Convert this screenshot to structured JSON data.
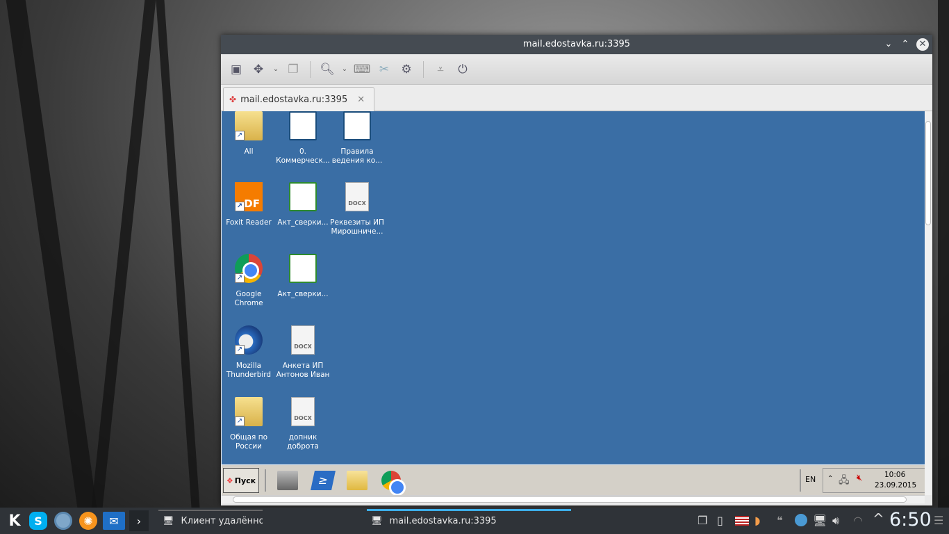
{
  "window": {
    "title": "mail.edostavka.ru:3395",
    "tab_label": "mail.edostavka.ru:3395"
  },
  "toolbar": {
    "icons": [
      "view-fullscreen-icon",
      "scale-icon",
      "dropdown",
      "multi-window-icon",
      "zoom-icon",
      "dropdown",
      "keyboard-icon",
      "tools-icon",
      "preferences-icon",
      "minimize-icon",
      "disconnect-icon"
    ]
  },
  "remote_desktop": {
    "background": "#3a6ea5",
    "icons": [
      {
        "label": "All",
        "type": "folder-shortcut"
      },
      {
        "label": "0. Коммерческ...",
        "type": "writer"
      },
      {
        "label": "Правила ведения ко...",
        "type": "writer"
      },
      {
        "label": "Foxit Reader",
        "type": "pdf-shortcut"
      },
      {
        "label": "Акт_сверки...",
        "type": "calc"
      },
      {
        "label": "Реквезиты ИП Мирошниче...",
        "type": "docx",
        "badge": "DOCX"
      },
      {
        "label": "Google Chrome",
        "type": "chrome-shortcut"
      },
      {
        "label": "Акт_сверки...",
        "type": "calc"
      },
      {
        "label": "Mozilla Thunderbird",
        "type": "thunderbird-shortcut"
      },
      {
        "label": "Анкета ИП Антонов Иван",
        "type": "docx",
        "badge": "DOCX"
      },
      {
        "label": "Общая по России",
        "type": "folder-shortcut"
      },
      {
        "label": "допник доброта",
        "type": "docx",
        "badge": "DOCX"
      }
    ],
    "taskbar": {
      "start_label": "Пуск",
      "language": "EN",
      "time": "10:06",
      "date": "23.09.2015"
    }
  },
  "panel": {
    "launchers": [
      "kde-menu",
      "skype",
      "chromium",
      "clementine",
      "mail"
    ],
    "tasks": [
      {
        "label": "Клиент удалённого рабочего стола Remm"
      },
      {
        "label": "mail.edostavka.ru:3395",
        "active": true
      }
    ],
    "clock": "6:50",
    "accent": "#3daee9"
  }
}
